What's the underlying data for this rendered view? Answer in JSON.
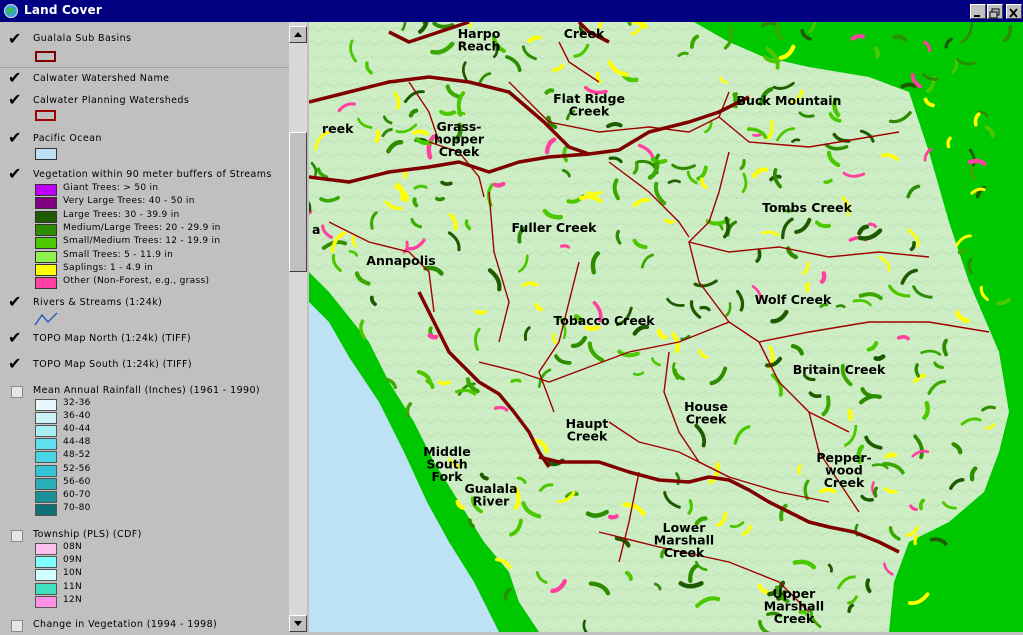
{
  "window": {
    "title": "Land Cover"
  },
  "toc": {
    "layers": [
      {
        "name": "Gualala Sub Basins",
        "checked": true,
        "symbol": "outline",
        "color": "#800000"
      },
      {
        "name": "Calwater Watershed Name",
        "checked": true
      },
      {
        "name": "Calwater Planning Watersheds",
        "checked": true,
        "symbol": "outline",
        "color": "#a00000"
      },
      {
        "name": "Pacific Ocean",
        "checked": true,
        "symbol": "fill",
        "color": "#bde1f5"
      },
      {
        "name": "Vegetation within 90 meter buffers of Streams",
        "checked": true
      },
      {
        "name": "Rivers & Streams (1:24k)",
        "checked": true
      },
      {
        "name": "TOPO Map North (1:24k) (TIFF)",
        "checked": true
      },
      {
        "name": "TOPO Map South (1:24k) (TIFF)",
        "checked": true
      },
      {
        "name": "Mean Annual Rainfall (Inches) (1961 - 1990)",
        "checked": false
      },
      {
        "name": "Township (PLS) (CDF)",
        "checked": false
      },
      {
        "name": "Change in Vegetation (1994 - 1998)",
        "checked": false
      }
    ],
    "vegetation_classes": [
      {
        "label": "Giant Trees: > 50 in",
        "color": "#c000ff"
      },
      {
        "label": "Very Large Trees: 40 - 50 in",
        "color": "#800080"
      },
      {
        "label": "Large Trees: 30 - 39.9 in",
        "color": "#1e5a00"
      },
      {
        "label": "Medium/Large Trees: 20 - 29.9 in",
        "color": "#2d8c00"
      },
      {
        "label": "Small/Medium Trees: 12 - 19.9 in",
        "color": "#4cc800"
      },
      {
        "label": "Small Trees: 5 - 11.9 in",
        "color": "#90f050"
      },
      {
        "label": "Saplings: 1 - 4.9 in",
        "color": "#ffff00"
      },
      {
        "label": "Other (Non-Forest, e.g., grass)",
        "color": "#ff40a0"
      }
    ],
    "rainfall_classes": [
      {
        "label": "32-36",
        "color": "#e8f8fc"
      },
      {
        "label": "36-40",
        "color": "#ccf2f8"
      },
      {
        "label": "40-44",
        "color": "#a8ecf4"
      },
      {
        "label": "44-48",
        "color": "#5ee0ee"
      },
      {
        "label": "48-52",
        "color": "#48d6e4"
      },
      {
        "label": "52-56",
        "color": "#34c4d4"
      },
      {
        "label": "56-60",
        "color": "#28aeb8"
      },
      {
        "label": "60-70",
        "color": "#1c9098"
      },
      {
        "label": "70-80",
        "color": "#107078"
      }
    ],
    "township_classes": [
      {
        "label": "08N",
        "color": "#ffc0f0"
      },
      {
        "label": "09N",
        "color": "#80ffff"
      },
      {
        "label": "10N",
        "color": "#d0ffff"
      },
      {
        "label": "11N",
        "color": "#40e0c0"
      },
      {
        "label": "12N",
        "color": "#ff90e8"
      }
    ]
  },
  "map": {
    "colors": {
      "land": "#c8ecc0",
      "ocean": "#bde1f5",
      "shore": "#00c800",
      "basin": "#800000",
      "watershed": "#a00000"
    },
    "labels": [
      "Harpo\nReach",
      "Creek",
      "Flat Ridge\nCreek",
      "Buck Mountain",
      "reek",
      "Grass-\nhopper\nCreek",
      "Tombs Creek",
      "Fuller Creek",
      "a",
      "Annapolis",
      "Wolf Creek",
      "Tobacco Creek",
      "Britain Creek",
      "House\nCreek",
      "Haupt\nCreek",
      "Middle\nSouth\nFork",
      "Gualala\nRiver",
      "Pepper-\nwood\nCreek",
      "Lower\nMarshall\nCreek",
      "Upper\nMarshall\nCreek"
    ]
  }
}
